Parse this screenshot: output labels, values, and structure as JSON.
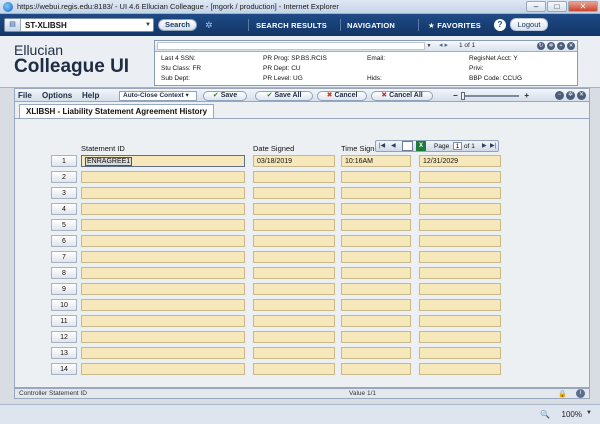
{
  "window": {
    "title": "https://webui.regis.edu:8183/ - UI 4.6 Ellucian Colleague - [mgork / production] - Internet Explorer",
    "min": "–",
    "max": "□",
    "close": "✕"
  },
  "topbar": {
    "form_value": "ST-XLIBSH",
    "search_label": "Search",
    "search_results": "SEARCH RESULTS",
    "navigation": "NAVIGATION",
    "favorites": "FAVORITES",
    "help": "?",
    "logout": "Logout"
  },
  "brand": {
    "line1": "Ellucian",
    "line2": "Colleague UI"
  },
  "context": {
    "page": "1 of 1",
    "fields": [
      {
        "label": "Last 4 SSN:",
        "value": ""
      },
      {
        "label": "PR Prog:",
        "value": "SP.BS.RCIS"
      },
      {
        "label": "Email:",
        "value": ""
      },
      {
        "label": "RegisNet Acct:",
        "value": "Y"
      },
      {
        "label": "Stu Class:",
        "value": "FR"
      },
      {
        "label": "PR Dept:",
        "value": "CU"
      },
      {
        "label": "Privi:",
        "value": ""
      },
      {
        "label": "Sub Dept:",
        "value": ""
      },
      {
        "label": "PR Level:",
        "value": "UG"
      },
      {
        "label": "Hids:",
        "value": ""
      },
      {
        "label": "BBP Code:",
        "value": "CCUG"
      }
    ]
  },
  "toolbar": {
    "file": "File",
    "options": "Options",
    "help": "Help",
    "auto_close": "Auto-Close Context",
    "save": "Save",
    "save_all": "Save All",
    "cancel": "Cancel",
    "cancel_all": "Cancel All"
  },
  "form": {
    "tab_title": "XLIBSH - Liability Statement Agreement History",
    "col_statement_id": "Statement ID",
    "col_date_signed": "Date Signed",
    "col_time_signed": "Time Signed",
    "pager_label": "Page",
    "pager_value": "1",
    "pager_of": "of 1",
    "rows": [
      {
        "num": "1",
        "statement_id": "ENRAGREE1",
        "date": "03/18/2019",
        "time": "10:16AM",
        "end": "12/31/2029"
      },
      {
        "num": "2",
        "statement_id": "",
        "date": "",
        "time": "",
        "end": ""
      },
      {
        "num": "3",
        "statement_id": "",
        "date": "",
        "time": "",
        "end": ""
      },
      {
        "num": "4",
        "statement_id": "",
        "date": "",
        "time": "",
        "end": ""
      },
      {
        "num": "5",
        "statement_id": "",
        "date": "",
        "time": "",
        "end": ""
      },
      {
        "num": "6",
        "statement_id": "",
        "date": "",
        "time": "",
        "end": ""
      },
      {
        "num": "7",
        "statement_id": "",
        "date": "",
        "time": "",
        "end": ""
      },
      {
        "num": "8",
        "statement_id": "",
        "date": "",
        "time": "",
        "end": ""
      },
      {
        "num": "9",
        "statement_id": "",
        "date": "",
        "time": "",
        "end": ""
      },
      {
        "num": "10",
        "statement_id": "",
        "date": "",
        "time": "",
        "end": ""
      },
      {
        "num": "11",
        "statement_id": "",
        "date": "",
        "time": "",
        "end": ""
      },
      {
        "num": "12",
        "statement_id": "",
        "date": "",
        "time": "",
        "end": ""
      },
      {
        "num": "13",
        "statement_id": "",
        "date": "",
        "time": "",
        "end": ""
      },
      {
        "num": "14",
        "statement_id": "",
        "date": "",
        "time": "",
        "end": ""
      }
    ]
  },
  "status": {
    "left": "Controller Statement ID",
    "mid": "Value 1/1",
    "info": "i"
  },
  "browser": {
    "zoom": "100%"
  },
  "icons": [
    "ie-icon",
    "form-icon",
    "gear-icon",
    "star-icon",
    "help-icon",
    "check-icon",
    "x-icon",
    "excel-icon",
    "lock-icon",
    "info-icon",
    "zoom-icon"
  ]
}
